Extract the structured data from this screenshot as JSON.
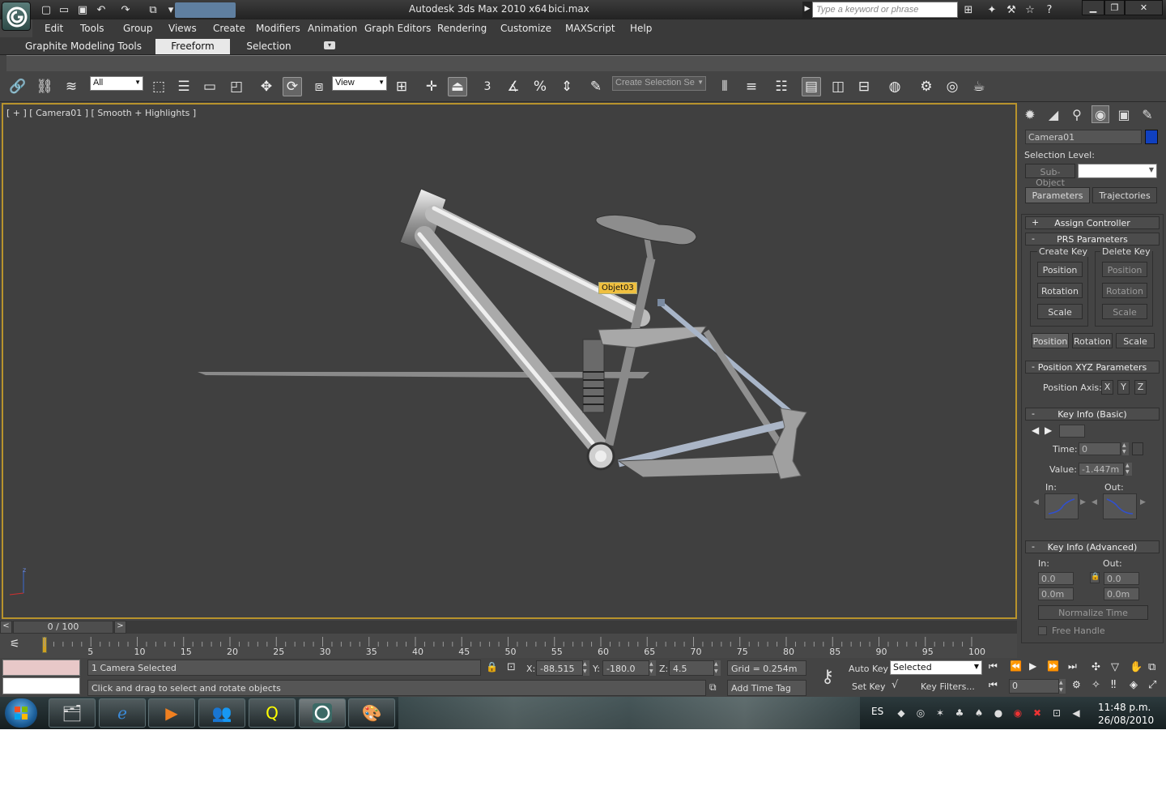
{
  "titlebar": {
    "title": "Autodesk 3ds Max  2010 x64",
    "file": "bici.max",
    "search_placeholder": "Type a keyword or phrase",
    "quick_access_icons": [
      "new-file-icon",
      "open-folder-icon",
      "save-icon",
      "undo-icon",
      "redo-icon",
      "project-folder-icon"
    ]
  },
  "menu": [
    "Edit",
    "Tools",
    "Group",
    "Views",
    "Create",
    "Modifiers",
    "Animation",
    "Graph Editors",
    "Rendering",
    "Customize",
    "MAXScript",
    "Help"
  ],
  "ribbon": {
    "tabs": [
      "Graphite Modeling Tools",
      "Freeform",
      "Selection"
    ],
    "active_tab": "Freeform"
  },
  "toolbar": {
    "selection_filter": "All",
    "reference_coord": "View",
    "snap_label": "3",
    "named_selection": "Create Selection Se"
  },
  "viewport": {
    "label": "[ + ] [ Camera01 ] [ Smooth + Highlights ]",
    "tooltip": "Objet03",
    "axis_z": "z"
  },
  "command_panel": {
    "object_name": "Camera01",
    "object_color": "#1040c0",
    "selection_level_label": "Selection Level:",
    "sub_object_label": "Sub-Object",
    "buttons": [
      "Parameters",
      "Trajectories"
    ],
    "rollouts": {
      "assign_controller": "Assign Controller",
      "prs_parameters": "PRS Parameters",
      "position_xyz": "Position XYZ Parameters",
      "key_info_basic": "Key Info (Basic)",
      "key_info_advanced": "Key Info (Advanced)"
    },
    "create_key": "Create Key",
    "delete_key": "Delete Key",
    "prs_buttons": [
      "Position",
      "Rotation",
      "Scale"
    ],
    "prs_tabs": [
      "Position",
      "Rotation",
      "Scale"
    ],
    "position_axis_label": "Position Axis:",
    "axes": [
      "X",
      "Y",
      "Z"
    ],
    "time_label": "Time:",
    "time_value": "0",
    "value_label": "Value:",
    "value_value": "-1.447m",
    "in_label": "In:",
    "out_label": "Out:",
    "adv_in_values": [
      "0.0",
      "0.0m"
    ],
    "adv_out_values": [
      "0.0",
      "0.0m"
    ],
    "normalize_time": "Normalize Time",
    "free_handle": "Free Handle"
  },
  "timeline": {
    "position": "0 / 100",
    "ticks": [
      "5",
      "10",
      "15",
      "20",
      "25",
      "30",
      "35",
      "40",
      "45",
      "50",
      "55",
      "60",
      "65",
      "70",
      "75",
      "80",
      "85",
      "90",
      "95",
      "100"
    ]
  },
  "status": {
    "selected": "1 Camera Selected",
    "prompt": "Click and drag to select and rotate objects",
    "x_label": "X:",
    "x_value": "-88.515",
    "y_label": "Y:",
    "y_value": "-180.0",
    "z_label": "Z:",
    "z_value": "4.5",
    "grid": "Grid = 0.254m",
    "add_time_tag": "Add Time Tag",
    "auto_key": "Auto Key",
    "set_key": "Set Key",
    "key_mode": "Selected",
    "key_filters": "Key Filters...",
    "frame_value": "0"
  },
  "taskbar": {
    "language": "ES",
    "time": "11:48 p.m.",
    "date": "26/08/2010"
  }
}
